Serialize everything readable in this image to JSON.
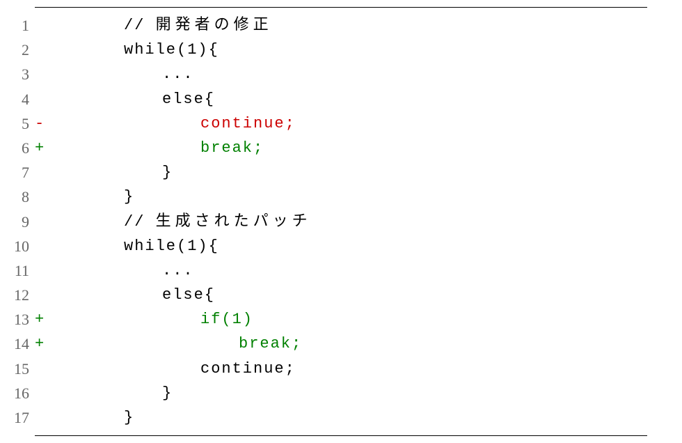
{
  "lines": [
    {
      "n": "1",
      "sign": "",
      "signClass": "",
      "indent": "indent0",
      "codeClass": "black",
      "prefix": "// ",
      "cjk": "開発者の修正",
      "suffix": ""
    },
    {
      "n": "2",
      "sign": "",
      "signClass": "",
      "indent": "indent0",
      "codeClass": "black",
      "prefix": "while(1){",
      "cjk": "",
      "suffix": ""
    },
    {
      "n": "3",
      "sign": "",
      "signClass": "",
      "indent": "indent1",
      "codeClass": "black",
      "prefix": "...",
      "cjk": "",
      "suffix": ""
    },
    {
      "n": "4",
      "sign": "",
      "signClass": "",
      "indent": "indent1",
      "codeClass": "black",
      "prefix": "else{",
      "cjk": "",
      "suffix": ""
    },
    {
      "n": "5",
      "sign": "-",
      "signClass": "red",
      "indent": "indent2",
      "codeClass": "red",
      "prefix": "continue;",
      "cjk": "",
      "suffix": ""
    },
    {
      "n": "6",
      "sign": "+",
      "signClass": "green",
      "indent": "indent2",
      "codeClass": "green",
      "prefix": "break;",
      "cjk": "",
      "suffix": ""
    },
    {
      "n": "7",
      "sign": "",
      "signClass": "",
      "indent": "indent1",
      "codeClass": "black",
      "prefix": "}",
      "cjk": "",
      "suffix": ""
    },
    {
      "n": "8",
      "sign": "",
      "signClass": "",
      "indent": "indent0",
      "codeClass": "black",
      "prefix": "}",
      "cjk": "",
      "suffix": ""
    },
    {
      "n": "9",
      "sign": "",
      "signClass": "",
      "indent": "indent0",
      "codeClass": "black",
      "prefix": "// ",
      "cjk": "生成されたパッチ",
      "suffix": ""
    },
    {
      "n": "10",
      "sign": "",
      "signClass": "",
      "indent": "indent0",
      "codeClass": "black",
      "prefix": "while(1){",
      "cjk": "",
      "suffix": ""
    },
    {
      "n": "11",
      "sign": "",
      "signClass": "",
      "indent": "indent1",
      "codeClass": "black",
      "prefix": "...",
      "cjk": "",
      "suffix": ""
    },
    {
      "n": "12",
      "sign": "",
      "signClass": "",
      "indent": "indent1",
      "codeClass": "black",
      "prefix": "else{",
      "cjk": "",
      "suffix": ""
    },
    {
      "n": "13",
      "sign": "+",
      "signClass": "green",
      "indent": "indent2",
      "codeClass": "green",
      "prefix": "if(1)",
      "cjk": "",
      "suffix": ""
    },
    {
      "n": "14",
      "sign": "+",
      "signClass": "green",
      "indent": "indent3",
      "codeClass": "green",
      "prefix": "break;",
      "cjk": "",
      "suffix": ""
    },
    {
      "n": "15",
      "sign": "",
      "signClass": "",
      "indent": "indent2",
      "codeClass": "black",
      "prefix": "continue;",
      "cjk": "",
      "suffix": ""
    },
    {
      "n": "16",
      "sign": "",
      "signClass": "",
      "indent": "indent1",
      "codeClass": "black",
      "prefix": "}",
      "cjk": "",
      "suffix": ""
    },
    {
      "n": "17",
      "sign": "",
      "signClass": "",
      "indent": "indent0",
      "codeClass": "black",
      "prefix": "}",
      "cjk": "",
      "suffix": ""
    }
  ]
}
